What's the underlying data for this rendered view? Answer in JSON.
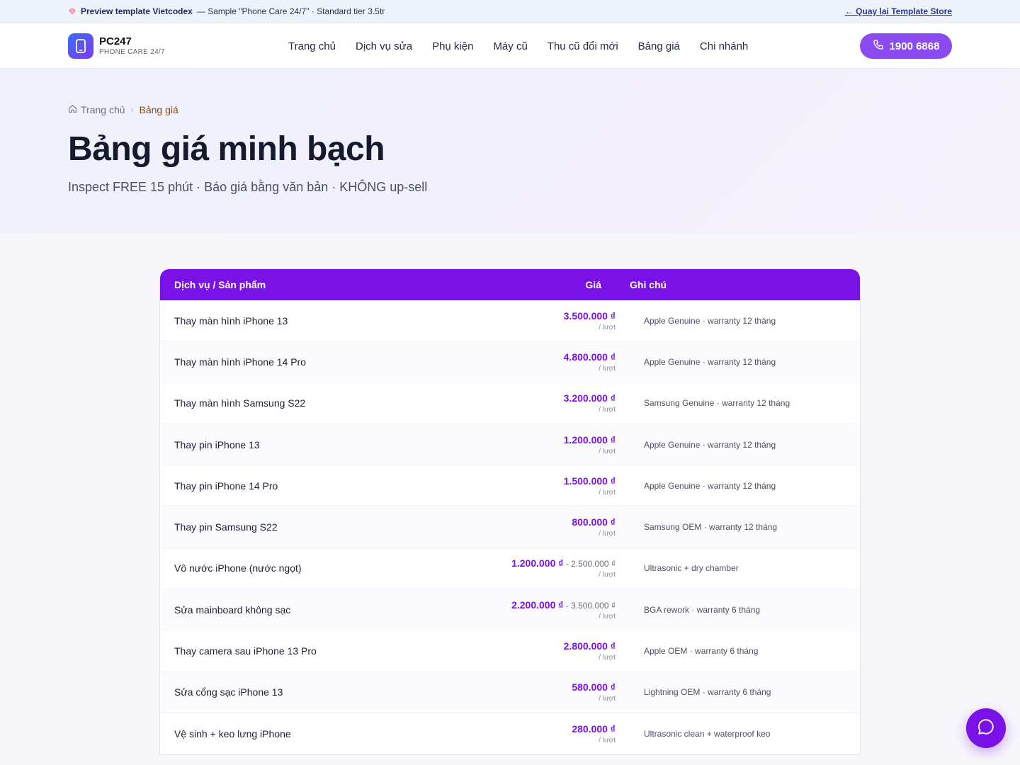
{
  "topbar": {
    "preview_label": "Preview template Vietcodex",
    "preview_desc": "— Sample \"Phone Care 24/7\" · Standard tier 3.5tr",
    "back_link": "← Quay lại Template Store"
  },
  "brand": {
    "name": "PC247",
    "tagline": "PHONE CARE 24/7"
  },
  "nav": {
    "items": [
      {
        "label": "Trang chủ"
      },
      {
        "label": "Dịch vụ sửa"
      },
      {
        "label": "Phụ kiện"
      },
      {
        "label": "Máy cũ"
      },
      {
        "label": "Thu cũ đổi mới"
      },
      {
        "label": "Bảng giá"
      },
      {
        "label": "Chi nhánh"
      }
    ],
    "phone": "1900 6868"
  },
  "breadcrumb": {
    "home": "Trang chủ",
    "current": "Bảng giá"
  },
  "hero": {
    "title": "Bảng giá minh bạch",
    "subtitle": "Inspect FREE 15 phút · Báo giá bằng văn bản · KHÔNG up-sell"
  },
  "table": {
    "headers": {
      "service": "Dịch vụ / Sản phẩm",
      "price": "Giá",
      "note": "Ghi chú"
    },
    "rows": [
      {
        "service": "Thay màn hình iPhone 13",
        "price": "3.500.000 ₫",
        "price_max": "",
        "unit": "/ lượt",
        "note": "Apple Genuine · warranty 12 tháng"
      },
      {
        "service": "Thay màn hình iPhone 14 Pro",
        "price": "4.800.000 ₫",
        "price_max": "",
        "unit": "/ lượt",
        "note": "Apple Genuine · warranty 12 tháng"
      },
      {
        "service": "Thay màn hình Samsung S22",
        "price": "3.200.000 ₫",
        "price_max": "",
        "unit": "/ lượt",
        "note": "Samsung Genuine · warranty 12 tháng"
      },
      {
        "service": "Thay pin iPhone 13",
        "price": "1.200.000 ₫",
        "price_max": "",
        "unit": "/ lượt",
        "note": "Apple Genuine · warranty 12 tháng"
      },
      {
        "service": "Thay pin iPhone 14 Pro",
        "price": "1.500.000 ₫",
        "price_max": "",
        "unit": "/ lượt",
        "note": "Apple Genuine · warranty 12 tháng"
      },
      {
        "service": "Thay pin Samsung S22",
        "price": "800.000 ₫",
        "price_max": "",
        "unit": "/ lượt",
        "note": "Samsung OEM · warranty 12 tháng"
      },
      {
        "service": "Vô nước iPhone (nước ngọt)",
        "price": "1.200.000 ₫",
        "price_max": " - 2.500.000 ₫",
        "unit": "/ lượt",
        "note": "Ultrasonic + dry chamber"
      },
      {
        "service": "Sửa mainboard không sạc",
        "price": "2.200.000 ₫",
        "price_max": " - 3.500.000 ₫",
        "unit": "/ lượt",
        "note": "BGA rework · warranty 6 tháng"
      },
      {
        "service": "Thay camera sau iPhone 13 Pro",
        "price": "2.800.000 ₫",
        "price_max": "",
        "unit": "/ lượt",
        "note": "Apple OEM · warranty 6 tháng"
      },
      {
        "service": "Sửa cổng sạc iPhone 13",
        "price": "580.000 ₫",
        "price_max": "",
        "unit": "/ lượt",
        "note": "Lightning OEM · warranty 6 tháng"
      },
      {
        "service": "Vệ sinh + keo lưng iPhone",
        "price": "280.000 ₫",
        "price_max": "",
        "unit": "/ lượt",
        "note": "Ultrasonic clean + waterproof keo"
      }
    ]
  },
  "colors": {
    "accent": "#7a12e8",
    "phone_button": "#8a4cf0",
    "logo_from": "#3d6bf5",
    "logo_to": "#7b3df0"
  }
}
